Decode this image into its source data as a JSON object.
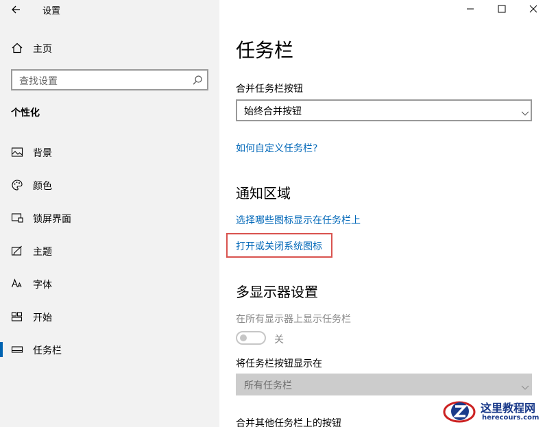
{
  "window": {
    "title": "设置"
  },
  "sidebar": {
    "home_label": "主页",
    "search_placeholder": "查找设置",
    "section_title": "个性化",
    "items": [
      {
        "label": "背景",
        "icon": "picture-icon"
      },
      {
        "label": "颜色",
        "icon": "palette-icon"
      },
      {
        "label": "锁屏界面",
        "icon": "lock-screen-icon"
      },
      {
        "label": "主题",
        "icon": "theme-icon"
      },
      {
        "label": "字体",
        "icon": "font-icon"
      },
      {
        "label": "开始",
        "icon": "start-icon"
      },
      {
        "label": "任务栏",
        "icon": "taskbar-icon",
        "active": true
      }
    ]
  },
  "main": {
    "title": "任务栏",
    "combine_label": "合并任务栏按钮",
    "combine_value": "始终合并按钮",
    "customize_link": "如何自定义任务栏?",
    "notify_heading": "通知区域",
    "notify_link1": "选择哪些图标显示在任务栏上",
    "notify_link2": "打开或关闭系统图标",
    "multi_heading": "多显示器设置",
    "multi_show_label": "在所有显示器上显示任务栏",
    "multi_toggle_state": "关",
    "show_buttons_label": "将任务栏按钮显示在",
    "show_buttons_value": "所有任务栏",
    "combine_other_label": "合并其他任务栏上的按钮"
  },
  "watermark": {
    "line1": "这里教程网",
    "line2": "herecours.com"
  },
  "colors": {
    "accent": "#0063b1",
    "link": "#0067b8",
    "highlight": "#d9534f"
  }
}
